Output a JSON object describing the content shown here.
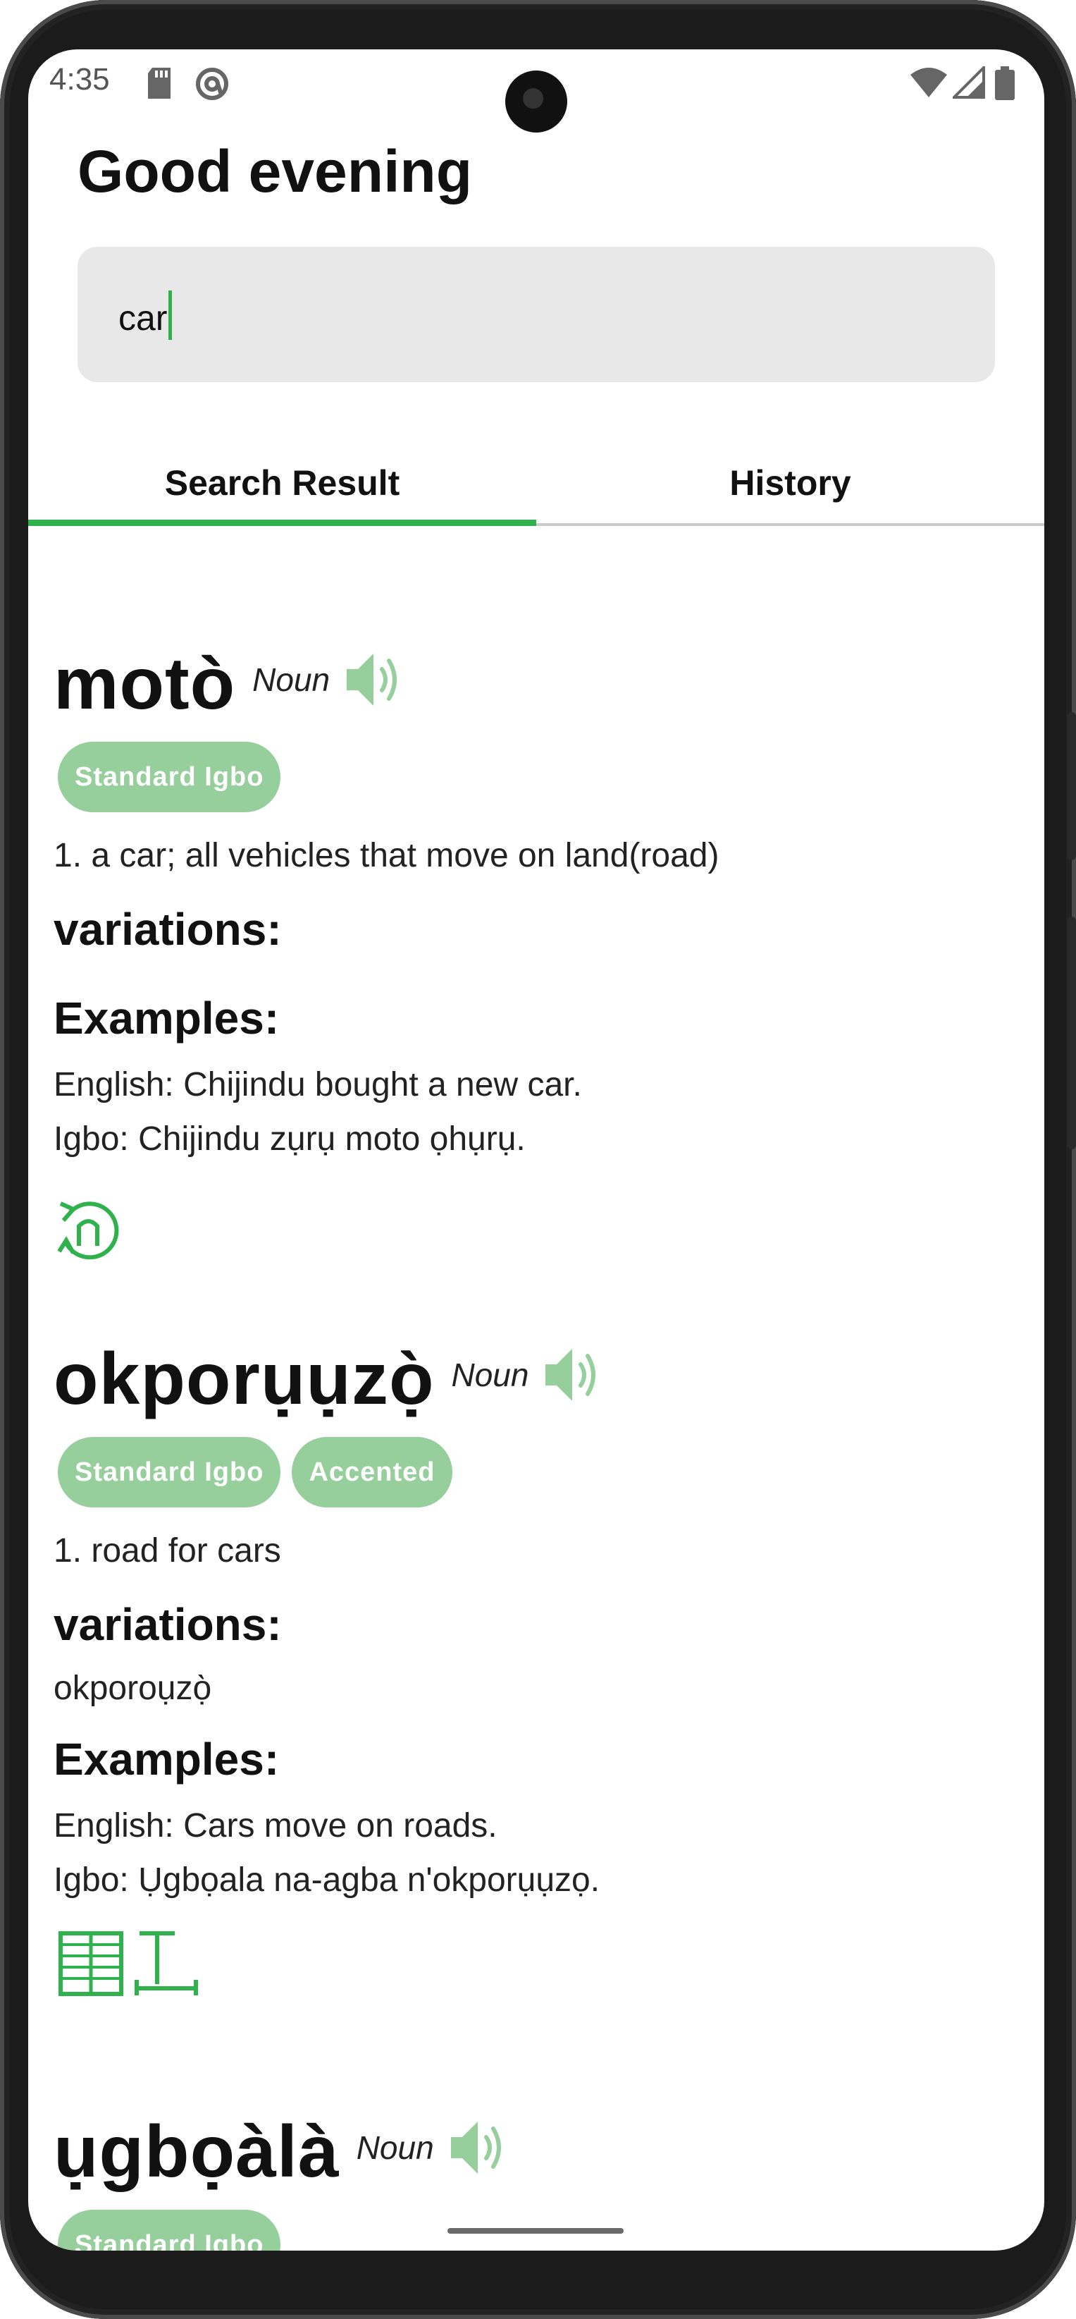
{
  "status_bar": {
    "time": "4:35"
  },
  "header": {
    "greeting": "Good evening"
  },
  "search": {
    "value": "car"
  },
  "tabs": [
    {
      "label": "Search Result",
      "active": true
    },
    {
      "label": "History",
      "active": false
    }
  ],
  "entries": [
    {
      "word": "motò",
      "pos": "Noun",
      "tags": [
        "Standard Igbo"
      ],
      "definition": "1. a car; all vehicles that move on land(road)",
      "variations_label": "variations:",
      "variations": "",
      "examples_label": "Examples:",
      "example_en": "English: Chijindu bought a new car.",
      "example_ig": "Igbo: Chijindu zụrụ moto ọhụrụ."
    },
    {
      "word": "okporụụzọ̀",
      "pos": "Noun",
      "tags": [
        "Standard Igbo",
        "Accented"
      ],
      "definition": "1. road for cars",
      "variations_label": "variations:",
      "variations": "okporoụzọ̀",
      "examples_label": "Examples:",
      "example_en": "English: Cars move on roads.",
      "example_ig": "Igbo: Ụgbọala na-agba n'okporụụzọ."
    },
    {
      "word": "ụgbọàlà",
      "pos": "Noun",
      "tags": [
        "Standard Igbo"
      ]
    }
  ],
  "colors": {
    "accent": "#2fb24c",
    "tag_bg": "#96cf9c"
  },
  "icons": [
    "sd-card-icon",
    "at-icon",
    "wifi-icon",
    "signal-icon",
    "battery-icon",
    "speaker-icon",
    "nsibidi-symbol-icon"
  ]
}
